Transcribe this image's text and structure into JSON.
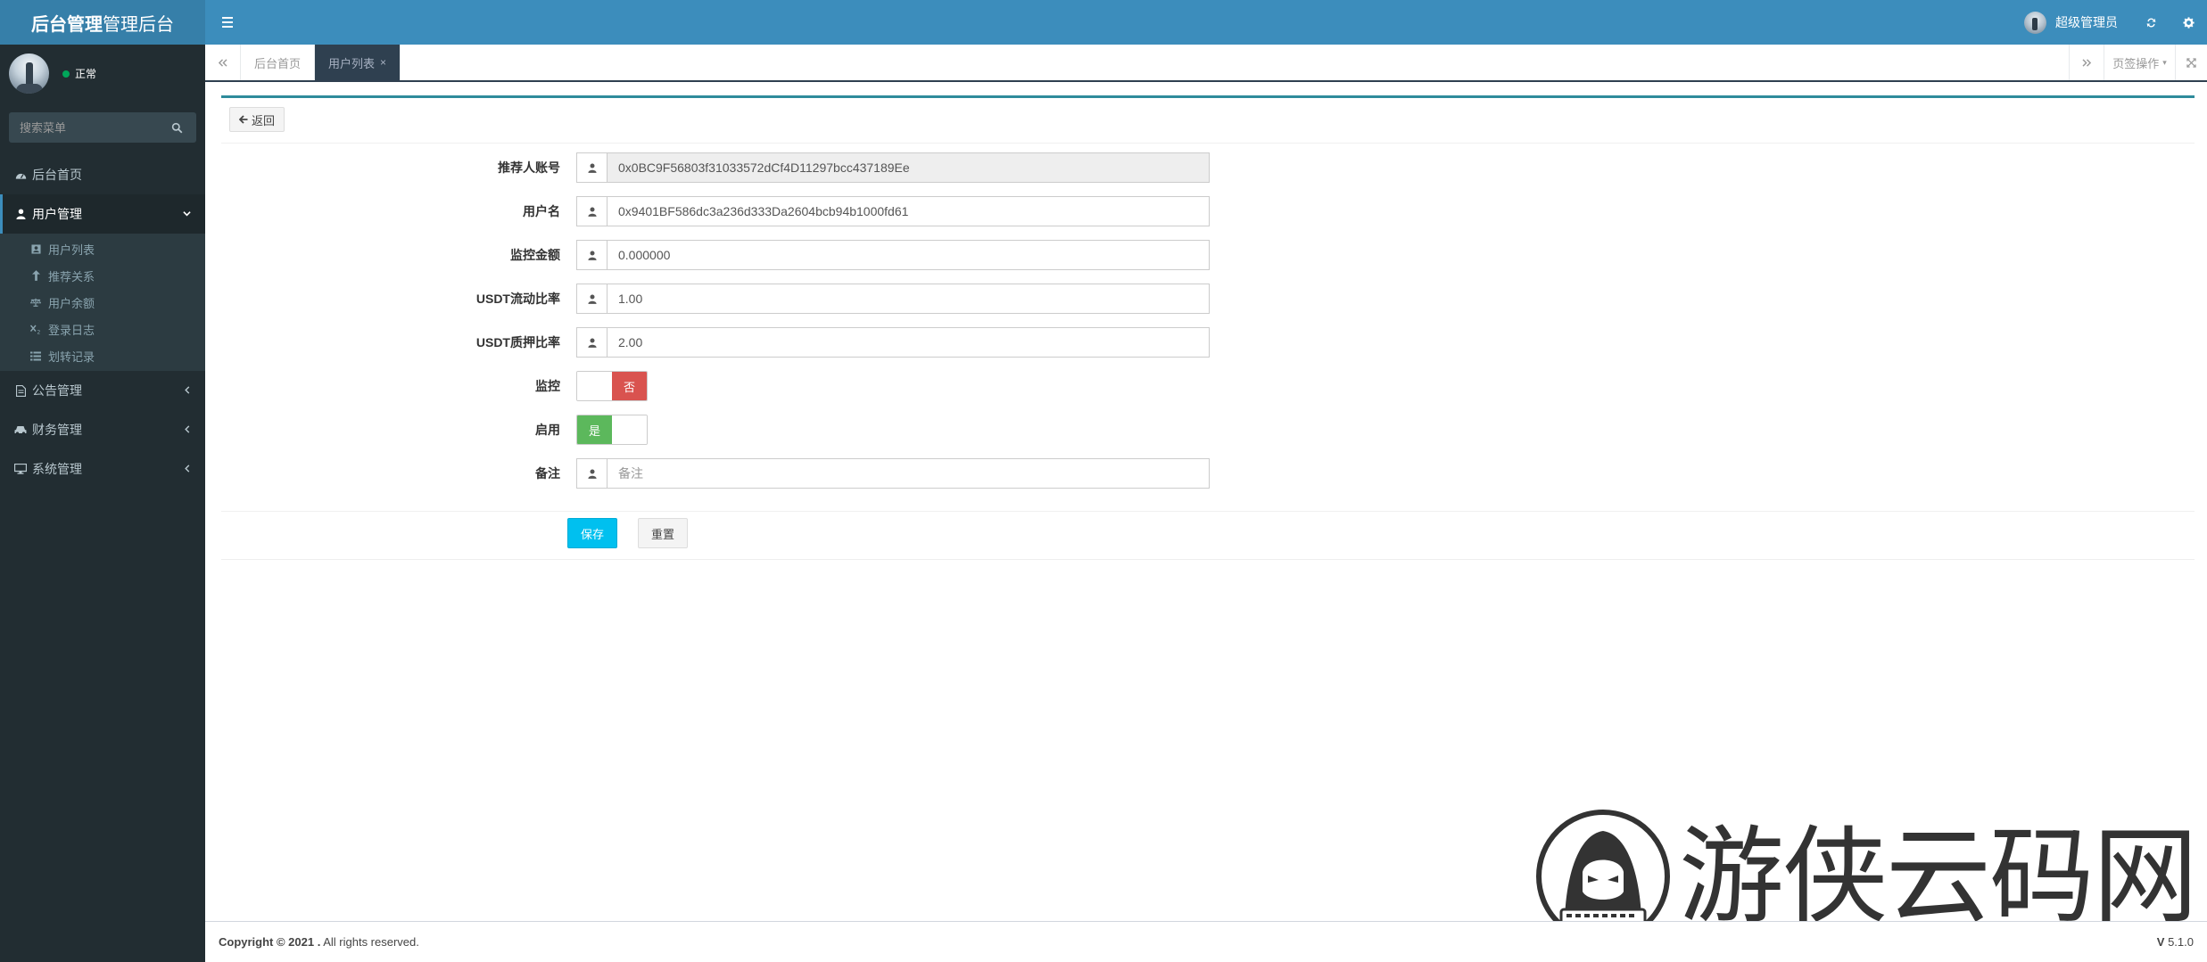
{
  "brand": {
    "bold": "后台管理",
    "normal": "管理后台"
  },
  "colors": {
    "header": "#3c8dbc",
    "logo_bg": "#367fa9",
    "sidebar": "#222d32",
    "tab_active": "#2f4050",
    "switch_off": "#d9534f",
    "switch_on": "#5cb85c",
    "save_btn": "#00c0ef"
  },
  "header": {
    "menu_toggle_icon": "hamburger-icon",
    "username": "超级管理员",
    "icons": [
      "refresh-icon",
      "gear-icon"
    ]
  },
  "sidebar": {
    "status": "正常",
    "search_placeholder": "搜索菜单",
    "menu": [
      {
        "label": "后台首页",
        "icon": "dashboard-icon"
      },
      {
        "label": "用户管理",
        "icon": "user-icon",
        "active": true,
        "children": [
          {
            "label": "用户列表",
            "icon": "id-card-icon"
          },
          {
            "label": "推荐关系",
            "icon": "arrow-up-icon"
          },
          {
            "label": "用户余额",
            "icon": "balance-scale-icon"
          },
          {
            "label": "登录日志",
            "icon": "subscript-icon"
          },
          {
            "label": "划转记录",
            "icon": "list-icon"
          }
        ]
      },
      {
        "label": "公告管理",
        "icon": "file-icon"
      },
      {
        "label": "财务管理",
        "icon": "car-icon"
      },
      {
        "label": "系统管理",
        "icon": "desktop-icon"
      }
    ]
  },
  "tabs": {
    "items": [
      {
        "label": "后台首页",
        "active": false
      },
      {
        "label": "用户列表",
        "active": true
      }
    ],
    "ops_label": "页签操作"
  },
  "form": {
    "back_label": "返回",
    "fields": [
      {
        "label": "推荐人账号",
        "value": "0x0BC9F56803f31033572dCf4D11297bcc437189Ee",
        "readonly": true
      },
      {
        "label": "用户名",
        "value": "0x9401BF586dc3a236d333Da2604bcb94b1000fd61"
      },
      {
        "label": "监控金额",
        "value": "0.000000"
      },
      {
        "label": "USDT流动比率",
        "value": "1.00"
      },
      {
        "label": "USDT质押比率",
        "value": "2.00"
      }
    ],
    "monitor": {
      "label": "监控",
      "state_text": "否",
      "enabled": false
    },
    "enable": {
      "label": "启用",
      "state_text": "是",
      "enabled": true
    },
    "remark": {
      "label": "备注",
      "placeholder": "备注",
      "value": ""
    },
    "save_label": "保存",
    "reset_label": "重置"
  },
  "watermark": {
    "text": "游侠云码网"
  },
  "footer": {
    "copyright_bold": "Copyright © 2021 .",
    "copyright_rest": " All rights reserved.",
    "version_bold": "V",
    "version_rest": " 5.1.0"
  }
}
